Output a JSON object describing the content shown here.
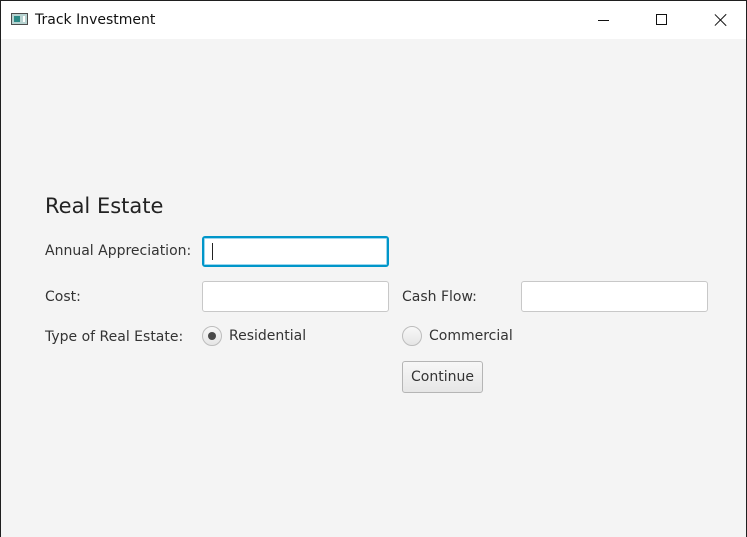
{
  "window": {
    "title": "Track Investment"
  },
  "form": {
    "heading": "Real Estate",
    "annual_appreciation_label": "Annual Appreciation:",
    "annual_appreciation_value": "",
    "cost_label": "Cost:",
    "cost_value": "",
    "cash_flow_label": "Cash Flow:",
    "cash_flow_value": "",
    "type_label": "Type of Real Estate:",
    "options": {
      "residential": "Residential",
      "commercial": "Commercial"
    },
    "selected_type": "Residential",
    "continue_label": "Continue"
  },
  "colors": {
    "focus": "#0096c9",
    "background": "#f4f4f4"
  },
  "icons": {
    "app": "app-icon",
    "minimize": "minimize-icon",
    "maximize": "maximize-icon",
    "close": "close-icon"
  }
}
